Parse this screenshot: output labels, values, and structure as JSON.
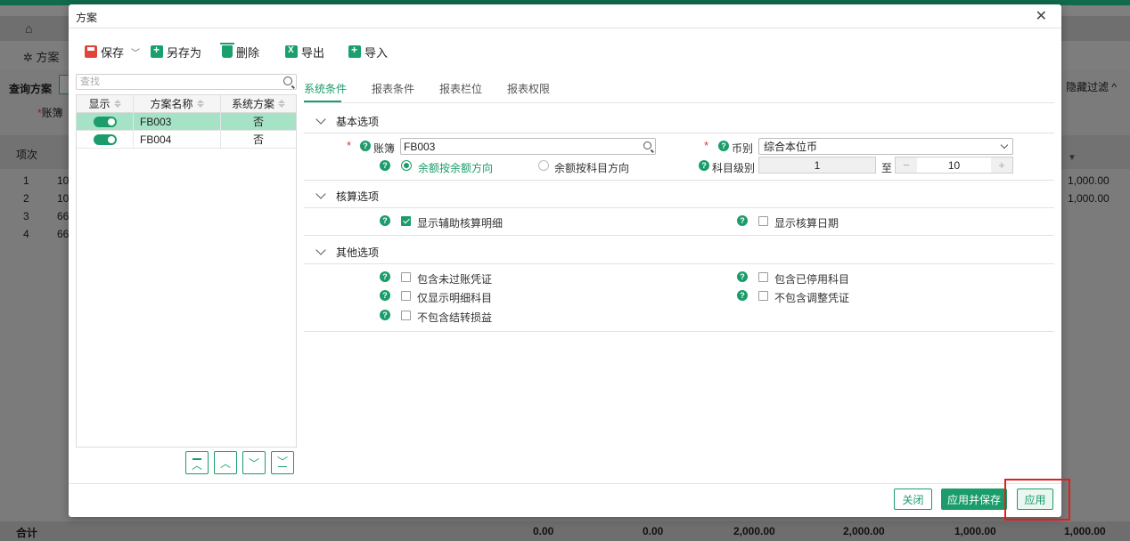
{
  "background": {
    "toolbar_scheme": "方案",
    "query_label": "查询方案",
    "acct_label": "账簿",
    "hide_filter": "隐藏过滤",
    "table_col_item": "项次",
    "rows": [
      {
        "idx": "1",
        "code": "10",
        "amount": "1,000.00"
      },
      {
        "idx": "2",
        "code": "10",
        "amount": "1,000.00"
      },
      {
        "idx": "3",
        "code": "66",
        "amount": ""
      },
      {
        "idx": "4",
        "code": "66",
        "amount": ""
      }
    ],
    "footer": {
      "label": "合计",
      "values": [
        "0.00",
        "0.00",
        "2,000.00",
        "2,000.00",
        "1,000.00",
        "1,000.00"
      ]
    }
  },
  "modal": {
    "title": "方案",
    "toolbar": {
      "save": "保存",
      "save_as": "另存为",
      "delete": "删除",
      "export": "导出",
      "import": "导入"
    },
    "search": {
      "placeholder": "查找"
    },
    "list": {
      "headers": {
        "show": "显示",
        "name": "方案名称",
        "system": "系统方案"
      },
      "rows": [
        {
          "name": "FB003",
          "system": "否",
          "enabled": true,
          "selected": true
        },
        {
          "name": "FB004",
          "system": "否",
          "enabled": true,
          "selected": false
        }
      ]
    },
    "tabs": [
      "系统条件",
      "报表条件",
      "报表栏位",
      "报表权限"
    ],
    "active_tab": "系统条件",
    "sections": {
      "basic": {
        "title": "基本选项",
        "account_label": "账簿",
        "account_value": "FB003",
        "currency_label": "币别",
        "currency_value": "综合本位币",
        "radio_balance_dir": "余额按余额方向",
        "radio_subject_dir": "余额按科目方向",
        "level_label": "科目级别",
        "level_from": "1",
        "level_to_label": "至",
        "level_to": "10",
        "minus": "−",
        "plus": "+"
      },
      "accounting": {
        "title": "核算选项",
        "show_aux_detail": "显示辅助核算明细",
        "show_acc_date": "显示核算日期"
      },
      "other": {
        "title": "其他选项",
        "include_unposted": "包含未过账凭证",
        "include_disabled": "包含已停用科目",
        "detail_only": "仅显示明细科目",
        "exclude_adjust": "不包含调整凭证",
        "exclude_carry": "不包含结转损益"
      }
    },
    "footer": {
      "close": "关闭",
      "apply_save": "应用并保存",
      "apply": "应用"
    }
  }
}
